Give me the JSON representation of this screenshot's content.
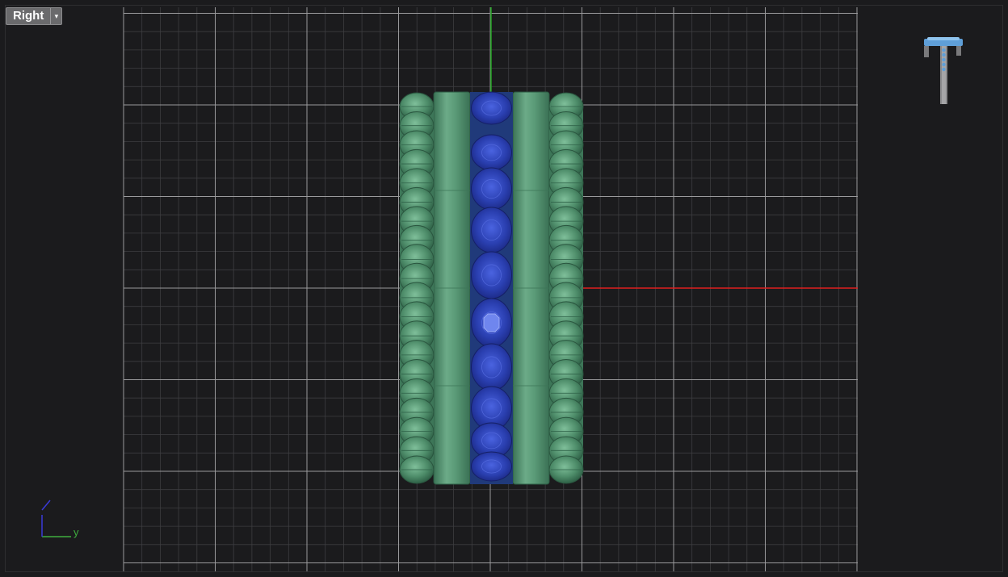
{
  "viewport": {
    "view_name": "Right",
    "dropdown_glyph": "▾",
    "background": "#1b1b1d"
  },
  "axis_triad": {
    "y_label": "y",
    "y_color": "#3fae3f",
    "z_color": "#3a3ad8"
  },
  "axes": {
    "vertical_axis_color": "#1fa31f",
    "horizontal_axis_color": "#e01f1f"
  },
  "grid": {
    "minor_color": "#3d3d40",
    "major_color": "#9a9a9c"
  },
  "model": {
    "metal_color": "#4f8f6d",
    "stone_color": "#2a3fb0",
    "side_bead_count": 20,
    "center_stone_count": 10
  },
  "nav_cube": {
    "icon": "ring-preview-icon"
  }
}
